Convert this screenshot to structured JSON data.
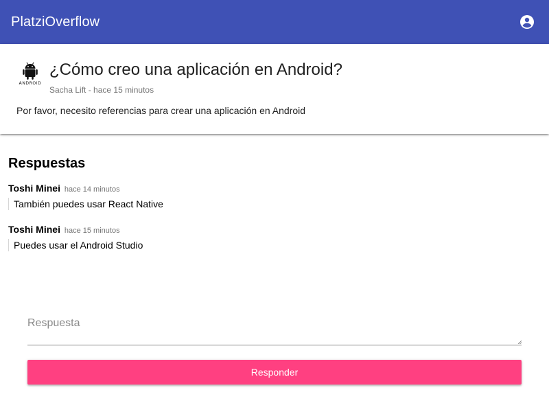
{
  "app": {
    "title": "PlatziOverflow",
    "toolbar_color": "#3f51b5",
    "account_icon": "account-circle-icon"
  },
  "question": {
    "icon": "android-icon",
    "icon_caption": "ANDROID",
    "title": "¿Cómo creo una aplicación en Android?",
    "author": "Sacha Lift",
    "separator": " - ",
    "time": "hace 15 minutos",
    "body": "Por favor, necesito referencias para crear una aplicación en Android"
  },
  "answers": {
    "heading": "Respuestas",
    "items": [
      {
        "author": "Toshi Minei",
        "time": "hace 14 minutos",
        "text": "También puedes usar React Native"
      },
      {
        "author": "Toshi Minei",
        "time": "hace 15 minutos",
        "text": "Puedes usar el Android Studio"
      }
    ]
  },
  "reply": {
    "placeholder": "Respuesta",
    "value": "",
    "button_label": "Responder",
    "button_color": "#ff4081"
  }
}
